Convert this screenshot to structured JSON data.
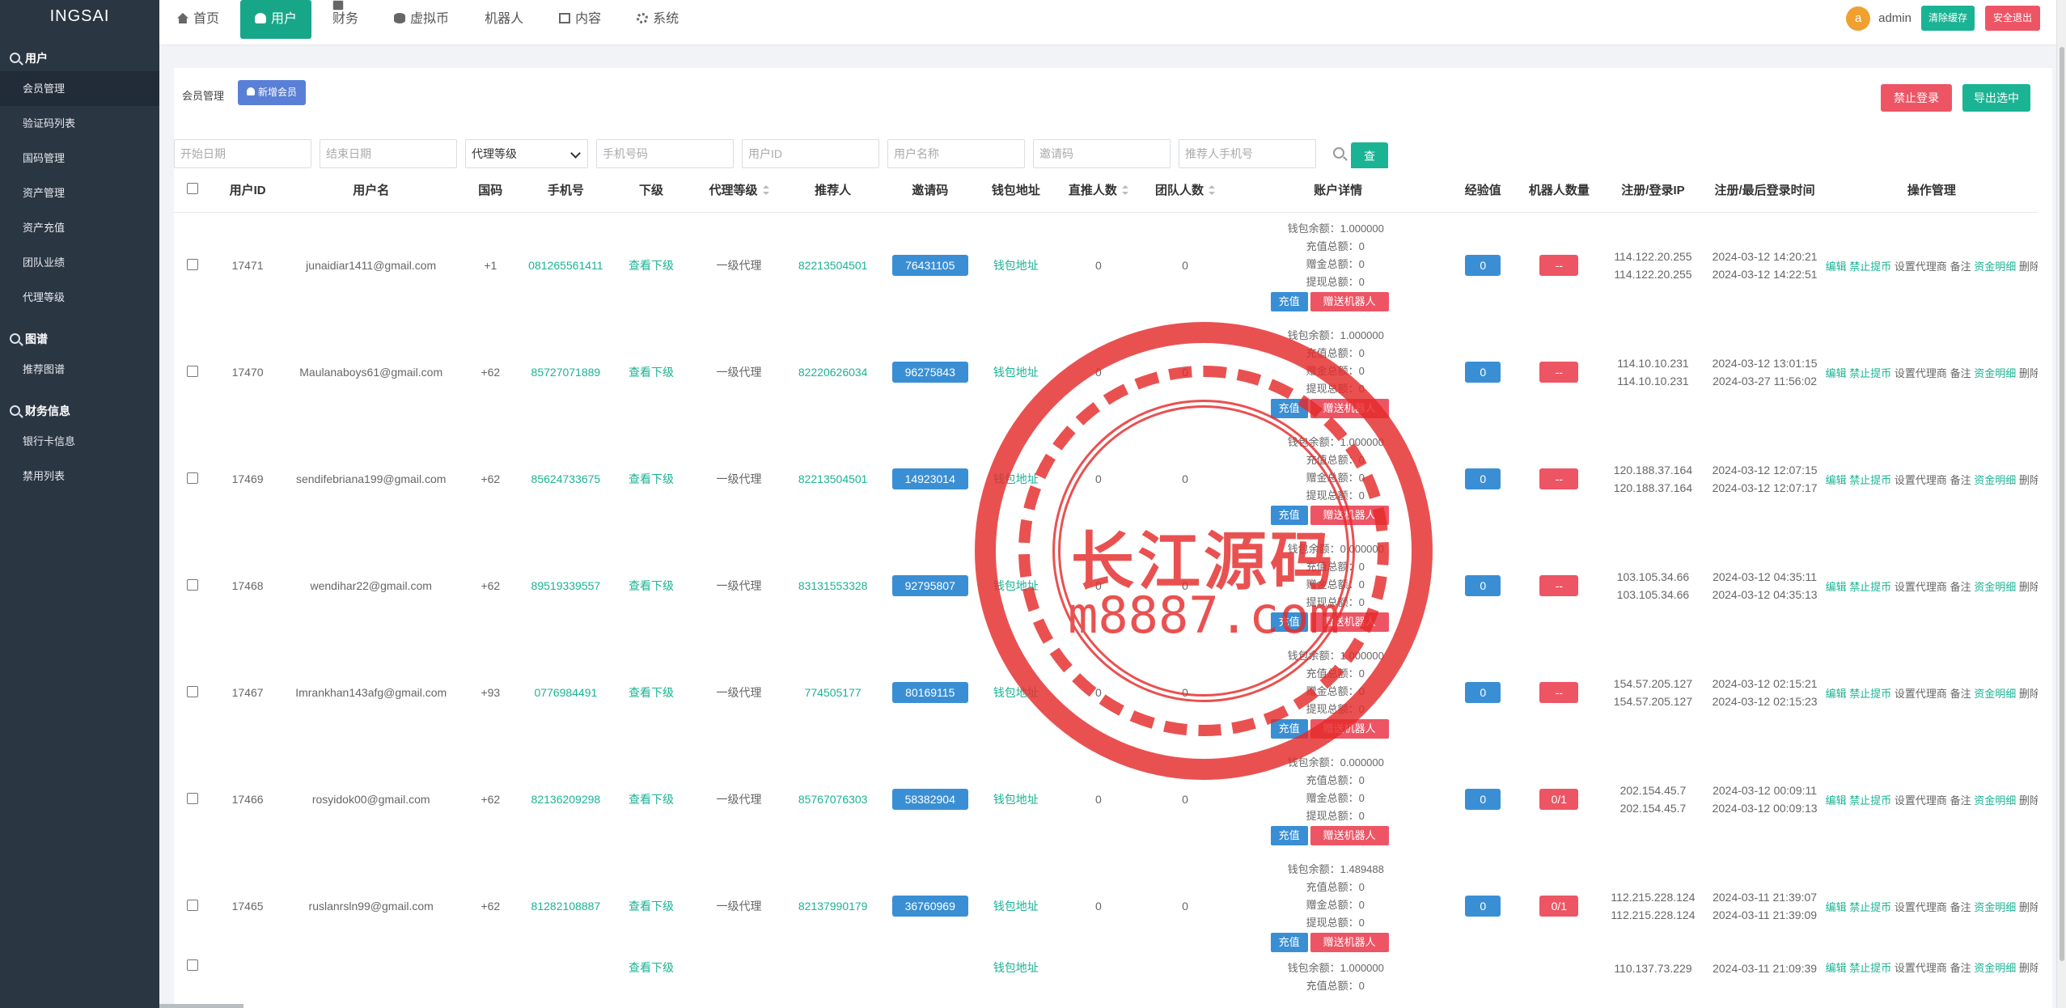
{
  "app": {
    "brand": "INGSAI"
  },
  "sidebar": {
    "groups": [
      {
        "label": "用户",
        "items": [
          "会员管理",
          "验证码列表",
          "国码管理",
          "资产管理",
          "资产充值",
          "团队业绩",
          "代理等级"
        ]
      },
      {
        "label": "图谱",
        "items": [
          "推荐图谱"
        ]
      },
      {
        "label": "财务信息",
        "items": [
          "银行卡信息",
          "禁用列表"
        ]
      }
    ],
    "active_item": "会员管理"
  },
  "nav": {
    "tabs": [
      "首页",
      "用户",
      "财务",
      "虚拟币",
      "机器人",
      "内容",
      "系统"
    ],
    "active": "用户"
  },
  "topright": {
    "avatar_letter": "a",
    "username": "admin",
    "clear_cache": "清除缓存",
    "logout": "安全退出"
  },
  "page": {
    "title": "会员管理",
    "add_member": "新增会员",
    "ban_login": "禁止登录",
    "export_selected": "导出选中"
  },
  "filters": {
    "start_date": "开始日期",
    "end_date": "结束日期",
    "agent_level": "代理等级",
    "phone": "手机号码",
    "user_id": "用户ID",
    "user_name": "用户名称",
    "invite_code": "邀请码",
    "referrer_phone": "推荐人手机号",
    "query": "查询"
  },
  "table": {
    "headers": [
      "用户ID",
      "用户名",
      "国码",
      "手机号",
      "下级",
      "代理等级",
      "推荐人",
      "邀请码",
      "钱包地址",
      "直推人数",
      "团队人数",
      "账户详情",
      "经验值",
      "机器人数量",
      "注册/登录IP",
      "注册/最后登录时间",
      "操作管理"
    ],
    "account_labels": {
      "wallet": "钱包余额：",
      "recharge": "充值总额：",
      "gift": "赠金总额：",
      "withdraw": "提现总额："
    },
    "row_labels": {
      "subordinates": "查看下级",
      "wallet_address": "钱包地址",
      "charge": "充值",
      "gift_robot": "赠送机器人"
    },
    "ops": {
      "edit": "编辑",
      "ban_withdraw": "禁止提币",
      "set_agent": "设置代理商",
      "note": "备注",
      "fund_detail": "资金明细",
      "delete": "删除"
    },
    "rows": [
      {
        "id": "17471",
        "name": "junaidiar1411@gmail.com",
        "cc": "+1",
        "phone": "081265561411",
        "level": "一级代理",
        "referrer": "82213504501",
        "invite": "76431105",
        "direct": "0",
        "team": "0",
        "wallet": "1.000000",
        "recharge": "0",
        "gift": "0",
        "withdraw": "0",
        "exp": "0",
        "robots": "--",
        "ip1": "114.122.20.255",
        "ip2": "114.122.20.255",
        "t1": "2024-03-12 14:20:21",
        "t2": "2024-03-12 14:22:51"
      },
      {
        "id": "17470",
        "name": "Maulanaboys61@gmail.com",
        "cc": "+62",
        "phone": "85727071889",
        "level": "一级代理",
        "referrer": "82220626034",
        "invite": "96275843",
        "direct": "0",
        "team": "0",
        "wallet": "1.000000",
        "recharge": "0",
        "gift": "0",
        "withdraw": "0",
        "exp": "0",
        "robots": "--",
        "ip1": "114.10.10.231",
        "ip2": "114.10.10.231",
        "t1": "2024-03-12 13:01:15",
        "t2": "2024-03-27 11:56:02"
      },
      {
        "id": "17469",
        "name": "sendifebriana199@gmail.com",
        "cc": "+62",
        "phone": "85624733675",
        "level": "一级代理",
        "referrer": "82213504501",
        "invite": "14923014",
        "direct": "0",
        "team": "0",
        "wallet": "1.000000",
        "recharge": "0",
        "gift": "0",
        "withdraw": "0",
        "exp": "0",
        "robots": "--",
        "ip1": "120.188.37.164",
        "ip2": "120.188.37.164",
        "t1": "2024-03-12 12:07:15",
        "t2": "2024-03-12 12:07:17"
      },
      {
        "id": "17468",
        "name": "wendihar22@gmail.com",
        "cc": "+62",
        "phone": "89519339557",
        "level": "一级代理",
        "referrer": "83131553328",
        "invite": "92795807",
        "direct": "0",
        "team": "0",
        "wallet": "0.000000",
        "recharge": "0",
        "gift": "0",
        "withdraw": "0",
        "exp": "0",
        "robots": "--",
        "ip1": "103.105.34.66",
        "ip2": "103.105.34.66",
        "t1": "2024-03-12 04:35:11",
        "t2": "2024-03-12 04:35:13"
      },
      {
        "id": "17467",
        "name": "Imrankhan143afg@gmail.com",
        "cc": "+93",
        "phone": "0776984491",
        "level": "一级代理",
        "referrer": "774505177",
        "invite": "80169115",
        "direct": "0",
        "team": "0",
        "wallet": "1.000000",
        "recharge": "0",
        "gift": "0",
        "withdraw": "0",
        "exp": "0",
        "robots": "--",
        "ip1": "154.57.205.127",
        "ip2": "154.57.205.127",
        "t1": "2024-03-12 02:15:21",
        "t2": "2024-03-12 02:15:23"
      },
      {
        "id": "17466",
        "name": "rosyidok00@gmail.com",
        "cc": "+62",
        "phone": "82136209298",
        "level": "一级代理",
        "referrer": "85767076303",
        "invite": "58382904",
        "direct": "0",
        "team": "0",
        "wallet": "0.000000",
        "recharge": "0",
        "gift": "0",
        "withdraw": "0",
        "exp": "0",
        "robots": "0/1",
        "ip1": "202.154.45.7",
        "ip2": "202.154.45.7",
        "t1": "2024-03-12 00:09:11",
        "t2": "2024-03-12 00:09:13"
      },
      {
        "id": "17465",
        "name": "ruslanrsln99@gmail.com",
        "cc": "+62",
        "phone": "81282108887",
        "level": "一级代理",
        "referrer": "82137990179",
        "invite": "36760969",
        "direct": "0",
        "team": "0",
        "wallet": "1.489488",
        "recharge": "0",
        "gift": "0",
        "withdraw": "0",
        "exp": "0",
        "robots": "0/1",
        "ip1": "112.215.228.124",
        "ip2": "112.215.228.124",
        "t1": "2024-03-11 21:39:07",
        "t2": "2024-03-11 21:39:09"
      },
      {
        "id": "",
        "name": "",
        "cc": "",
        "phone": "",
        "level": "",
        "referrer": "",
        "invite": "",
        "direct": "",
        "team": "",
        "wallet": "1.000000",
        "recharge": "0",
        "gift": "",
        "withdraw": "",
        "exp": "",
        "robots": "",
        "ip1": "110.137.73.229",
        "ip2": "",
        "t1": "2024-03-11 21:09:39",
        "t2": ""
      }
    ]
  },
  "watermark": {
    "title": "长江源码",
    "url": "m8887.com"
  }
}
